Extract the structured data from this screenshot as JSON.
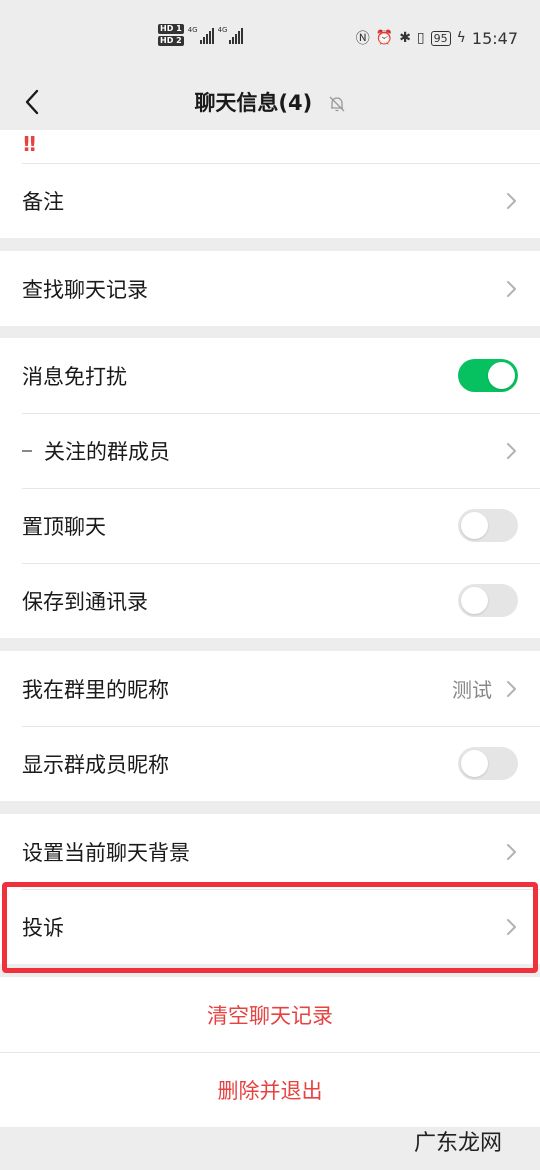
{
  "status_bar": {
    "hd1": "HD 1",
    "hd2": "HD 2",
    "net1": "4G",
    "net2": "4G",
    "battery": "95",
    "time": "15:47"
  },
  "nav": {
    "title": "聊天信息(4)",
    "back_icon": "chevron-left-icon",
    "mute_icon": "bell-off-icon"
  },
  "top_group": {
    "alert": "!!",
    "remark_label": "备注"
  },
  "search_group": {
    "find_history_label": "查找聊天记录"
  },
  "settings_group": {
    "mute_label": "消息免打扰",
    "mute_on": true,
    "followed_members_label": "关注的群成员",
    "pin_label": "置顶聊天",
    "pin_on": false,
    "save_contacts_label": "保存到通讯录",
    "save_contacts_on": false
  },
  "nickname_group": {
    "my_nickname_label": "我在群里的昵称",
    "my_nickname_value": "测试",
    "show_nicknames_label": "显示群成员昵称",
    "show_nicknames_on": false
  },
  "background_group": {
    "set_background_label": "设置当前聊天背景",
    "complain_label": "投诉"
  },
  "actions": {
    "clear_history": "清空聊天记录",
    "delete_exit": "删除并退出"
  },
  "colors": {
    "accent_green": "#07c160",
    "danger_red": "#e64340",
    "highlight_red": "#f0303a"
  },
  "watermark": "广东龙网"
}
